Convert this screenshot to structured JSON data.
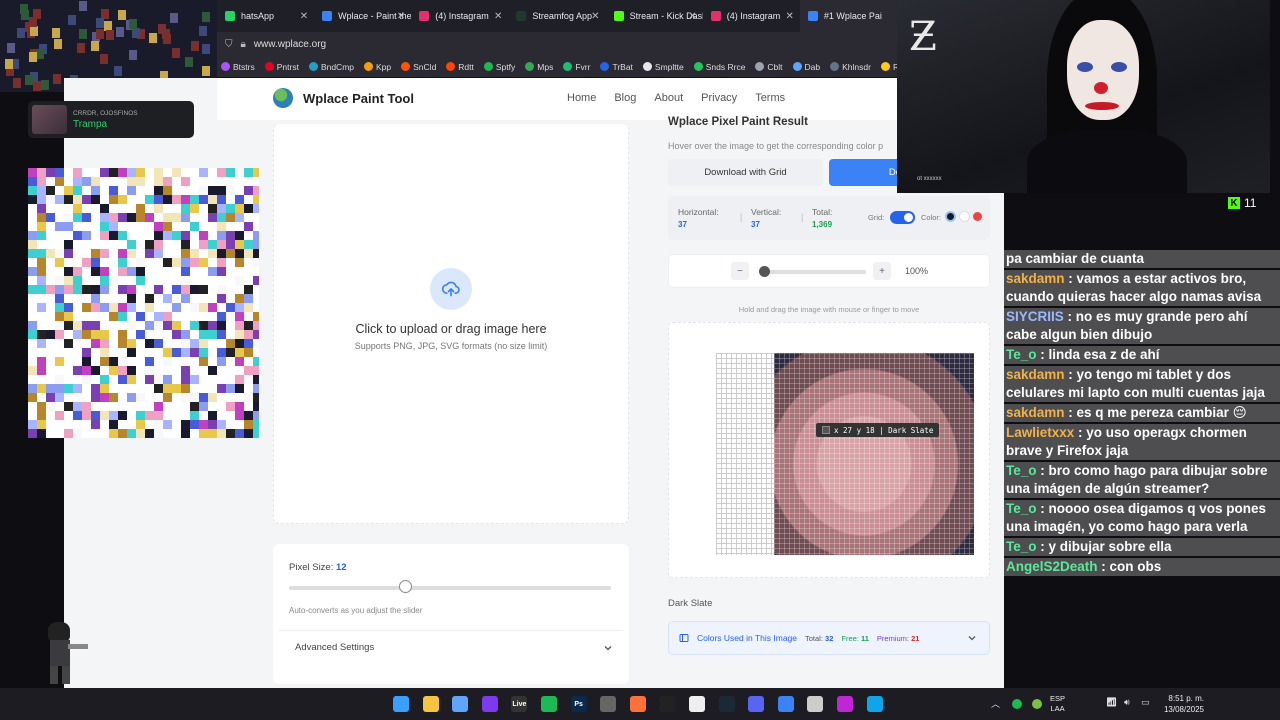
{
  "browser": {
    "tabs": [
      {
        "title": "hatsApp",
        "color": "#25d366",
        "active": false
      },
      {
        "title": "Wplace - Paint the",
        "color": "#3b82f6",
        "active": false
      },
      {
        "title": "(4) Instagram",
        "color": "#e1306c",
        "active": false
      },
      {
        "title": "Streamfog App",
        "color": "#1e3a2a",
        "active": false
      },
      {
        "title": "Stream - Kick Dashb",
        "color": "#53fc18",
        "active": false
      },
      {
        "title": "(4) Instagram",
        "color": "#e1306c",
        "active": false
      },
      {
        "title": "#1 Wplace Pai",
        "color": "#3b82f6",
        "active": true
      }
    ],
    "url": "www.wplace.org",
    "bookmarks": [
      {
        "label": "Btstrs",
        "color": "#a855f7"
      },
      {
        "label": "Pntrst",
        "color": "#e60023"
      },
      {
        "label": "BndCmp",
        "color": "#1da0c3"
      },
      {
        "label": "Kpp",
        "color": "#f59e0b"
      },
      {
        "label": "SnCld",
        "color": "#ff5500"
      },
      {
        "label": "Rdtt",
        "color": "#ff4500"
      },
      {
        "label": "Sptfy",
        "color": "#1db954"
      },
      {
        "label": "Mps",
        "color": "#34a853"
      },
      {
        "label": "Fvrr",
        "color": "#1dbf73"
      },
      {
        "label": "TrBat",
        "color": "#2563eb"
      },
      {
        "label": "Smpltte",
        "color": "#e5e7eb"
      },
      {
        "label": "Snds Rrce",
        "color": "#22c55e"
      },
      {
        "label": "Cblt",
        "color": "#9ca3af"
      },
      {
        "label": "Dab",
        "color": "#60a5fa"
      },
      {
        "label": "Khlnsdr",
        "color": "#64748b"
      },
      {
        "label": "RmvBkg",
        "color": "#facc15"
      }
    ]
  },
  "site": {
    "brand": "Wplace Paint Tool",
    "nav": [
      "Home",
      "Blog",
      "About",
      "Privacy",
      "Terms"
    ]
  },
  "upload": {
    "title": "Click to upload or drag image here",
    "subtitle": "Supports PNG, JPG, SVG formats (no size limit)"
  },
  "settings": {
    "pixel_size_label": "Pixel Size:",
    "pixel_size_value": "12",
    "pixel_size_fraction": 0.36,
    "auto_note": "Auto-converts as you adjust the slider",
    "advanced": "Advanced Settings"
  },
  "result": {
    "title": "Wplace Pixel Paint Result",
    "hint": "Hover over the image to get the corresponding color p",
    "btn_grid": "Download with Grid",
    "btn_download": "Do",
    "stats": {
      "horizontal_label": "Horizontal:",
      "horizontal": "37",
      "vertical_label": "Vertical:",
      "vertical": "37",
      "total_label": "Total:",
      "total": "1,369",
      "grid_label": "Grid:",
      "color_label": "Color:"
    },
    "color_options": [
      "#111827",
      "#ffffff",
      "#ef4444"
    ],
    "zoom": {
      "minus": "−",
      "plus": "+",
      "value": "100%",
      "fraction": 0.0
    },
    "hold_note": "Hold and drag the image with mouse or finger to move",
    "tooltip": "x 27 y 18 | Dark Slate",
    "selected_color": "Dark Slate",
    "colors_used": {
      "label": "Colors Used in This Image",
      "total_label": "Total:",
      "total": "32",
      "free_label": "Free:",
      "free": "11",
      "premium_label": "Premium:",
      "premium": "21"
    }
  },
  "now_playing": {
    "artist": "CRRDR, OJOSFINOS",
    "track": "Trampa"
  },
  "webcam": {
    "watermark": "ot xxxxxx"
  },
  "kick": {
    "viewers": "11"
  },
  "chat": [
    {
      "user": "",
      "msg": "pa cambiar de cuanta",
      "color": "#ffffff"
    },
    {
      "user": "sakdamn",
      "msg": " : vamos a estar activos bro, cuando quieras hacer algo namas avisa",
      "color": "#f0b24a"
    },
    {
      "user": "SIYCRIIS",
      "msg": " : no es muy grande pero ahí cabe algun bien dibujo",
      "color": "#9ab8ff"
    },
    {
      "user": "Te_o",
      "msg": " : linda esa z de ahí",
      "color": "#5be89a"
    },
    {
      "user": "sakdamn",
      "msg": " : yo tengo mi tablet y dos celulares mi lapto con multi cuentas jaja",
      "color": "#f0b24a"
    },
    {
      "user": "sakdamn",
      "msg": " : es q me pereza cambiar 😔",
      "color": "#f0b24a"
    },
    {
      "user": "Lawlietxxx",
      "msg": " : yo uso operagx chormen brave y Firefox jaja",
      "color": "#f0b24a"
    },
    {
      "user": "Te_o",
      "msg": " : bro como hago para dibujar sobre una imágen de algún streamer?",
      "color": "#5be89a"
    },
    {
      "user": "Te_o",
      "msg": " : noooo osea digamos q vos pones una imagén, yo como hago para verla",
      "color": "#5be89a"
    },
    {
      "user": "Te_o",
      "msg": " : y dibujar sobre ella",
      "color": "#5be89a"
    },
    {
      "user": "AngelS2Death",
      "msg": " : con obs",
      "color": "#5be89a"
    }
  ],
  "taskbar": {
    "apps": [
      {
        "name": "windows",
        "label": "",
        "color": "#3aa0ff"
      },
      {
        "name": "files",
        "label": "",
        "color": "#f5c542"
      },
      {
        "name": "notepad",
        "label": "",
        "color": "#60a5fa"
      },
      {
        "name": "app-purple",
        "label": "",
        "color": "#7c3aed"
      },
      {
        "name": "live",
        "label": "Live",
        "color": "#333"
      },
      {
        "name": "spotify",
        "label": "",
        "color": "#1db954"
      },
      {
        "name": "photoshop",
        "label": "Ps",
        "color": "#0b2a4a"
      },
      {
        "name": "app-gray",
        "label": "",
        "color": "#666"
      },
      {
        "name": "firefox",
        "label": "",
        "color": "#ff7139"
      },
      {
        "name": "app-dark",
        "label": "",
        "color": "#222"
      },
      {
        "name": "app-white",
        "label": "",
        "color": "#eee"
      },
      {
        "name": "steam",
        "label": "",
        "color": "#1b2838"
      },
      {
        "name": "discord",
        "label": "",
        "color": "#5865f2"
      },
      {
        "name": "app-blue",
        "label": "",
        "color": "#3b82f6"
      },
      {
        "name": "app-clock",
        "label": "",
        "color": "#ccc"
      },
      {
        "name": "app-magenta",
        "label": "",
        "color": "#c026d3"
      },
      {
        "name": "edge",
        "label": "",
        "color": "#0ea5e9"
      }
    ],
    "lang": "ESP",
    "region": "LAA",
    "time": "8:51 p. m.",
    "date": "13/08/2025"
  }
}
